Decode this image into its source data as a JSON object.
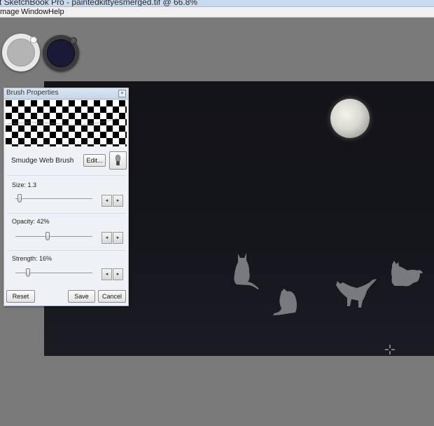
{
  "window": {
    "title": "t SketchBook Pro - paintedkittyesmerged.tif @ 66.8%"
  },
  "menu": {
    "items": [
      "mage",
      "Window",
      "Help"
    ]
  },
  "colors": {
    "primary_puck": "#b4b4b4",
    "secondary_puck": "#181a36",
    "canvas": "#15161c",
    "panel_bg": "#eef2f7"
  },
  "brush_panel": {
    "title": "Brush Properties",
    "close_icon": "×",
    "brush_name": "Smudge Web Brush",
    "edit_label": "Edit...",
    "size": {
      "label": "Size: 1.3",
      "value": 0.05
    },
    "opacity": {
      "label": "Opacity: 42%",
      "value": 0.42
    },
    "strength": {
      "label": "Strength: 16%",
      "value": 0.16
    },
    "stepper": {
      "left": "◂",
      "right": "▸"
    },
    "reset_label": "Reset",
    "save_label": "Save",
    "cancel_label": "Cancel"
  }
}
